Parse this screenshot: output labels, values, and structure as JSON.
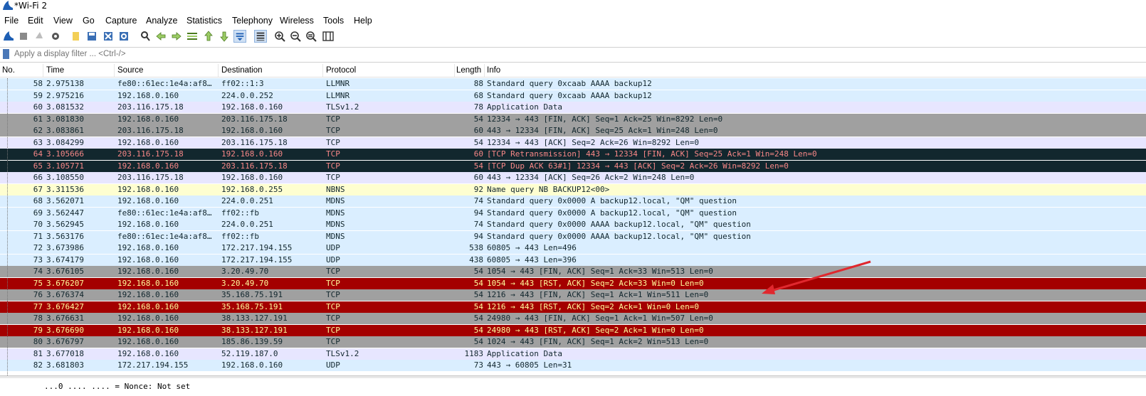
{
  "window": {
    "title": "*Wi-Fi 2"
  },
  "menu": [
    "File",
    "Edit",
    "View",
    "Go",
    "Capture",
    "Analyze",
    "Statistics",
    "Telephony",
    "Wireless",
    "Tools",
    "Help"
  ],
  "toolbar": [
    {
      "icon": "shark-fin-start-icon"
    },
    {
      "icon": "stop-icon"
    },
    {
      "icon": "restart-icon"
    },
    {
      "icon": "gear-icon"
    },
    {
      "icon": "open-file-icon"
    },
    {
      "icon": "save-file-icon"
    },
    {
      "icon": "close-file-icon"
    },
    {
      "icon": "reload-icon"
    },
    {
      "icon": "search-icon"
    },
    {
      "icon": "arrow-left-icon"
    },
    {
      "icon": "arrow-right-icon"
    },
    {
      "icon": "go-to-packet-icon"
    },
    {
      "icon": "first-packet-icon"
    },
    {
      "icon": "last-packet-icon"
    },
    {
      "icon": "autoscroll-icon",
      "active": true
    },
    {
      "icon": "colorize-icon",
      "active": true
    },
    {
      "icon": "zoom-in-icon"
    },
    {
      "icon": "zoom-out-icon"
    },
    {
      "icon": "zoom-reset-icon"
    },
    {
      "icon": "resize-columns-icon"
    }
  ],
  "filter": {
    "placeholder": "Apply a display filter ... <Ctrl-/>"
  },
  "columns": {
    "no": "No.",
    "time": "Time",
    "source": "Source",
    "destination": "Destination",
    "protocol": "Protocol",
    "length": "Length",
    "info": "Info"
  },
  "packets": [
    {
      "no": "58",
      "time": "2.975138",
      "source": "fe80::61ec:1e4a:af8…",
      "destination": "ff02::1:3",
      "protocol": "LLMNR",
      "length": "88",
      "info": "Standard query 0xcaab AAAA backup12",
      "bg": "#daeeff",
      "fg": "#12272e"
    },
    {
      "no": "59",
      "time": "2.975216",
      "source": "192.168.0.160",
      "destination": "224.0.0.252",
      "protocol": "LLMNR",
      "length": "68",
      "info": "Standard query 0xcaab AAAA backup12",
      "bg": "#daeeff",
      "fg": "#12272e"
    },
    {
      "no": "60",
      "time": "3.081532",
      "source": "203.116.175.18",
      "destination": "192.168.0.160",
      "protocol": "TLSv1.2",
      "length": "78",
      "info": "Application Data",
      "bg": "#e7e6ff",
      "fg": "#12272e"
    },
    {
      "no": "61",
      "time": "3.081830",
      "source": "192.168.0.160",
      "destination": "203.116.175.18",
      "protocol": "TCP",
      "length": "54",
      "info": "12334 → 443 [FIN, ACK] Seq=1 Ack=25 Win=8292 Len=0",
      "bg": "#a0a0a0",
      "fg": "#12272e"
    },
    {
      "no": "62",
      "time": "3.083861",
      "source": "203.116.175.18",
      "destination": "192.168.0.160",
      "protocol": "TCP",
      "length": "60",
      "info": "443 → 12334 [FIN, ACK] Seq=25 Ack=1 Win=248 Len=0",
      "bg": "#a0a0a0",
      "fg": "#12272e"
    },
    {
      "no": "63",
      "time": "3.084299",
      "source": "192.168.0.160",
      "destination": "203.116.175.18",
      "protocol": "TCP",
      "length": "54",
      "info": "12334 → 443 [ACK] Seq=2 Ack=26 Win=8292 Len=0",
      "bg": "#e7e6ff",
      "fg": "#12272e"
    },
    {
      "no": "64",
      "time": "3.105666",
      "source": "203.116.175.18",
      "destination": "192.168.0.160",
      "protocol": "TCP",
      "length": "60",
      "info": "[TCP Retransmission] 443 → 12334 [FIN, ACK] Seq=25 Ack=1 Win=248 Len=0",
      "bg": "#12272e",
      "fg": "#f78787"
    },
    {
      "no": "65",
      "time": "3.105771",
      "source": "192.168.0.160",
      "destination": "203.116.175.18",
      "protocol": "TCP",
      "length": "54",
      "info": "[TCP Dup ACK 63#1] 12334 → 443 [ACK] Seq=2 Ack=26 Win=8292 Len=0",
      "bg": "#12272e",
      "fg": "#f78787"
    },
    {
      "no": "66",
      "time": "3.108550",
      "source": "203.116.175.18",
      "destination": "192.168.0.160",
      "protocol": "TCP",
      "length": "60",
      "info": "443 → 12334 [ACK] Seq=26 Ack=2 Win=248 Len=0",
      "bg": "#e7e6ff",
      "fg": "#12272e"
    },
    {
      "no": "67",
      "time": "3.311536",
      "source": "192.168.0.160",
      "destination": "192.168.0.255",
      "protocol": "NBNS",
      "length": "92",
      "info": "Name query NB BACKUP12<00>",
      "bg": "#fefed0",
      "fg": "#12272e"
    },
    {
      "no": "68",
      "time": "3.562071",
      "source": "192.168.0.160",
      "destination": "224.0.0.251",
      "protocol": "MDNS",
      "length": "74",
      "info": "Standard query 0x0000 A backup12.local, \"QM\" question",
      "bg": "#daeeff",
      "fg": "#12272e"
    },
    {
      "no": "69",
      "time": "3.562447",
      "source": "fe80::61ec:1e4a:af8…",
      "destination": "ff02::fb",
      "protocol": "MDNS",
      "length": "94",
      "info": "Standard query 0x0000 A backup12.local, \"QM\" question",
      "bg": "#daeeff",
      "fg": "#12272e"
    },
    {
      "no": "70",
      "time": "3.562945",
      "source": "192.168.0.160",
      "destination": "224.0.0.251",
      "protocol": "MDNS",
      "length": "74",
      "info": "Standard query 0x0000 AAAA backup12.local, \"QM\" question",
      "bg": "#daeeff",
      "fg": "#12272e"
    },
    {
      "no": "71",
      "time": "3.563176",
      "source": "fe80::61ec:1e4a:af8…",
      "destination": "ff02::fb",
      "protocol": "MDNS",
      "length": "94",
      "info": "Standard query 0x0000 AAAA backup12.local, \"QM\" question",
      "bg": "#daeeff",
      "fg": "#12272e"
    },
    {
      "no": "72",
      "time": "3.673986",
      "source": "192.168.0.160",
      "destination": "172.217.194.155",
      "protocol": "UDP",
      "length": "538",
      "info": "60805 → 443 Len=496",
      "bg": "#daeeff",
      "fg": "#12272e"
    },
    {
      "no": "73",
      "time": "3.674179",
      "source": "192.168.0.160",
      "destination": "172.217.194.155",
      "protocol": "UDP",
      "length": "438",
      "info": "60805 → 443 Len=396",
      "bg": "#daeeff",
      "fg": "#12272e"
    },
    {
      "no": "74",
      "time": "3.676105",
      "source": "192.168.0.160",
      "destination": "3.20.49.70",
      "protocol": "TCP",
      "length": "54",
      "info": "1054 → 443 [FIN, ACK] Seq=1 Ack=33 Win=513 Len=0",
      "bg": "#a0a0a0",
      "fg": "#12272e"
    },
    {
      "no": "75",
      "time": "3.676207",
      "source": "192.168.0.160",
      "destination": "3.20.49.70",
      "protocol": "TCP",
      "length": "54",
      "info": "1054 → 443 [RST, ACK] Seq=2 Ack=33 Win=0 Len=0",
      "bg": "#a40000",
      "fg": "#fffc9c"
    },
    {
      "no": "76",
      "time": "3.676374",
      "source": "192.168.0.160",
      "destination": "35.168.75.191",
      "protocol": "TCP",
      "length": "54",
      "info": "1216 → 443 [FIN, ACK] Seq=1 Ack=1 Win=511 Len=0",
      "bg": "#a0a0a0",
      "fg": "#12272e"
    },
    {
      "no": "77",
      "time": "3.676427",
      "source": "192.168.0.160",
      "destination": "35.168.75.191",
      "protocol": "TCP",
      "length": "54",
      "info": "1216 → 443 [RST, ACK] Seq=2 Ack=1 Win=0 Len=0",
      "bg": "#a40000",
      "fg": "#fffc9c"
    },
    {
      "no": "78",
      "time": "3.676631",
      "source": "192.168.0.160",
      "destination": "38.133.127.191",
      "protocol": "TCP",
      "length": "54",
      "info": "24980 → 443 [FIN, ACK] Seq=1 Ack=1 Win=507 Len=0",
      "bg": "#a0a0a0",
      "fg": "#12272e"
    },
    {
      "no": "79",
      "time": "3.676690",
      "source": "192.168.0.160",
      "destination": "38.133.127.191",
      "protocol": "TCP",
      "length": "54",
      "info": "24980 → 443 [RST, ACK] Seq=2 Ack=1 Win=0 Len=0",
      "bg": "#a40000",
      "fg": "#fffc9c"
    },
    {
      "no": "80",
      "time": "3.676797",
      "source": "192.168.0.160",
      "destination": "185.86.139.59",
      "protocol": "TCP",
      "length": "54",
      "info": "1024 → 443 [FIN, ACK] Seq=1 Ack=2 Win=513 Len=0",
      "bg": "#a0a0a0",
      "fg": "#12272e"
    },
    {
      "no": "81",
      "time": "3.677018",
      "source": "192.168.0.160",
      "destination": "52.119.187.0",
      "protocol": "TLSv1.2",
      "length": "1183",
      "info": "Application Data",
      "bg": "#e7e6ff",
      "fg": "#12272e"
    },
    {
      "no": "82",
      "time": "3.681803",
      "source": "172.217.194.155",
      "destination": "192.168.0.160",
      "protocol": "UDP",
      "length": "73",
      "info": "443 → 60805 Len=31",
      "bg": "#daeeff",
      "fg": "#12272e"
    }
  ],
  "detail": {
    "line": "...0 .... .... = Nonce: Not set"
  },
  "annotation": {
    "color": "#e0282e"
  }
}
